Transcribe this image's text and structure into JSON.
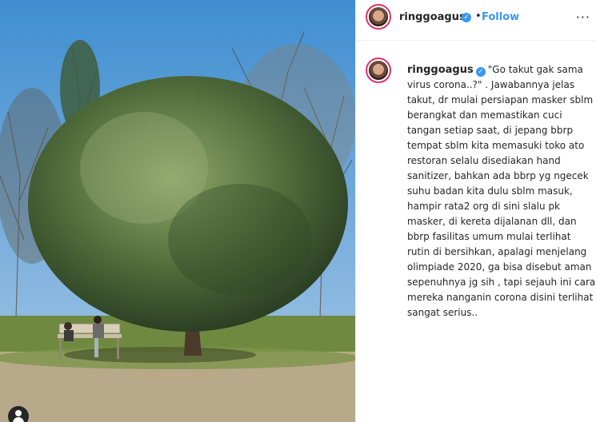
{
  "post": {
    "username": "ringgoagus",
    "verified_glyph": "✓",
    "dot": "•",
    "follow_label": "Follow",
    "more_label": "···",
    "caption": "\"Go takut gak sama virus corona..?\" . Jawabannya jelas takut, dr mulai persiapan masker sblm berangkat dan memastikan cuci tangan setiap saat, di jepang bbrp tempat sblm kita memasuki toko ato restoran selalu disediakan hand sanitizer, bahkan ada bbrp yg ngecek suhu badan kita dulu sblm masuk, hampir rata2 org di sini slalu pk masker, di kereta dijalanan dll, dan bbrp fasilitas umum mulai terlihat rutin di bersihkan, apalagi menjelang olimpiade 2020, ga bisa disebut aman sepenuhnya jg sih , tapi sejauh ini cara mereka nanganin corona disini terlihat sangat serius.."
  },
  "colors": {
    "accent": "#3897f0",
    "text": "#262626",
    "story_ring": "#e1306c"
  },
  "icons": {
    "verified": "verified-badge-icon",
    "tag": "user-tag-icon",
    "more": "more-options-icon"
  }
}
